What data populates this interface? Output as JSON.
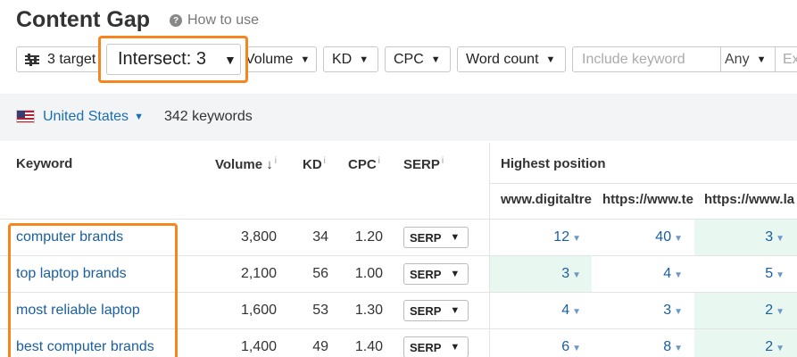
{
  "header": {
    "title": "Content Gap",
    "how_to_use": "How to use"
  },
  "filters": {
    "targets": "3 target",
    "intersect": "Intersect: 3",
    "volume": "Volume",
    "kd": "KD",
    "cpc": "CPC",
    "word_count": "Word count",
    "include_placeholder": "Include keyword",
    "any": "Any",
    "exclude_partial": "Ex"
  },
  "infobar": {
    "country": "United States",
    "keyword_count": "342 keywords"
  },
  "table": {
    "headers": {
      "keyword": "Keyword",
      "volume": "Volume",
      "volume_sort": "↓",
      "kd": "KD",
      "cpc": "CPC",
      "serp": "SERP",
      "info": "i",
      "highest_position": "Highest position"
    },
    "sites": [
      "www.digitaltre",
      "https://www.te",
      "https://www.la"
    ],
    "rows": [
      {
        "keyword": "computer brands",
        "volume": "3,800",
        "kd": "34",
        "cpc": "1.20",
        "serp": "SERP",
        "positions": [
          "12",
          "40",
          "3"
        ],
        "highlight": [
          false,
          false,
          true
        ]
      },
      {
        "keyword": "top laptop brands",
        "volume": "2,100",
        "kd": "56",
        "cpc": "1.00",
        "serp": "SERP",
        "positions": [
          "3",
          "4",
          "5"
        ],
        "highlight": [
          true,
          false,
          false
        ]
      },
      {
        "keyword": "most reliable laptop",
        "volume": "1,600",
        "kd": "53",
        "cpc": "1.30",
        "serp": "SERP",
        "positions": [
          "4",
          "3",
          "2"
        ],
        "highlight": [
          false,
          false,
          true
        ]
      },
      {
        "keyword": "best computer brands",
        "volume": "1,400",
        "kd": "49",
        "cpc": "1.40",
        "serp": "SERP",
        "positions": [
          "6",
          "8",
          "2"
        ],
        "highlight": [
          false,
          false,
          true
        ]
      }
    ]
  },
  "colors": {
    "accent_highlight": "#f5861f",
    "link": "#1a5fa0",
    "best_position_bg": "#e8f7ef"
  }
}
